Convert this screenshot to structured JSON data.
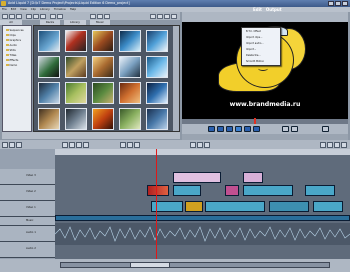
{
  "window": {
    "title": "Avid Liquid 7 [D:\\b7 Demo Project\\Projects\\Liquid Edition 6 Demo_project]"
  },
  "menu": [
    "File",
    "Edit",
    "View",
    "Clip",
    "Library",
    "Timeline",
    "Help"
  ],
  "modes": [
    "Edit",
    "Output"
  ],
  "library_tabs": [
    "All",
    "Racks",
    "Library",
    "Music"
  ],
  "tree_items": [
    "Sequences",
    "Clips",
    "Graphics",
    "Audio",
    "Stills",
    "Titles",
    "Effects",
    "Demo"
  ],
  "context_menu": [
    "B.T.C. Offset",
    "Import clips...",
    "Import audio...",
    "Import...",
    "Delete tile...",
    "Smooth Motion"
  ],
  "preview": {
    "url": "www.brandmedia.ru"
  },
  "tracks": [
    "Video 3",
    "Video 2",
    "Video 1",
    "Music",
    "Audio 1",
    "Audio 2"
  ],
  "colors": {
    "titlebar": "#3d5a8a",
    "playhead": "#e01818",
    "clip": "#4aa7c8",
    "preview_bg": "#000000"
  }
}
